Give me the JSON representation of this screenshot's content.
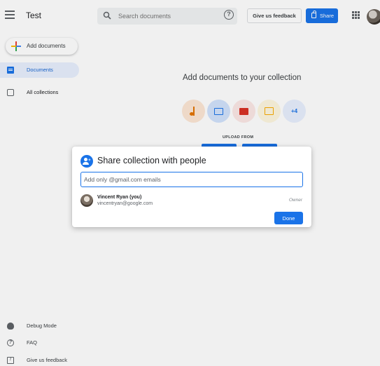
{
  "header": {
    "title": "Test",
    "search_placeholder": "Search documents",
    "feedback_label": "Give us feedback",
    "share_label": "Share"
  },
  "sidebar": {
    "add_documents": "Add documents",
    "items": [
      {
        "label": "Documents",
        "active": true
      },
      {
        "label": "All collections",
        "active": false
      }
    ],
    "bottom": [
      {
        "label": "Debug Mode",
        "icon": "bug-icon"
      },
      {
        "label": "FAQ",
        "icon": "help-icon"
      },
      {
        "label": "Give us feedback",
        "icon": "feedback-icon"
      }
    ]
  },
  "main": {
    "heading": "Add documents to your collection",
    "more_formats": "+4",
    "upload_from": "UPLOAD FROM"
  },
  "dialog": {
    "title": "Share collection with people",
    "email_placeholder": "Add only @gmail.com emails",
    "email_value": "",
    "person": {
      "name": "Vincent Ryan (you)",
      "email": "vincentryan@google.com",
      "role": "Owner"
    },
    "done_label": "Done"
  },
  "colors": {
    "accent": "#1a73e8",
    "active_nav_bg": "#e8f0fe",
    "text_primary": "#202124",
    "text_secondary": "#5f6368"
  }
}
